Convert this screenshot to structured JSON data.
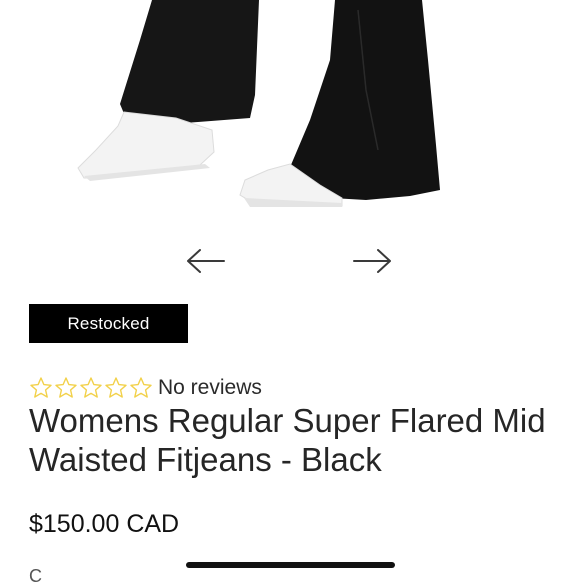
{
  "product": {
    "image_icon": "product-photo-flared-jeans-white-sneakers",
    "badge": "Restocked",
    "rating": {
      "stars_filled": 0,
      "stars_total": 5,
      "star_color": "#f2d14a",
      "text": "No reviews"
    },
    "title": "Womens Regular Super Flared Mid Waisted Fitjeans - Black",
    "price": "$150.00 CAD",
    "next_section_label": "C"
  },
  "gallery": {
    "prev_icon": "arrow-left-icon",
    "next_icon": "arrow-right-icon"
  },
  "colors": {
    "badge_background": "#000000",
    "badge_text": "#ffffff",
    "denim": "#151515"
  }
}
